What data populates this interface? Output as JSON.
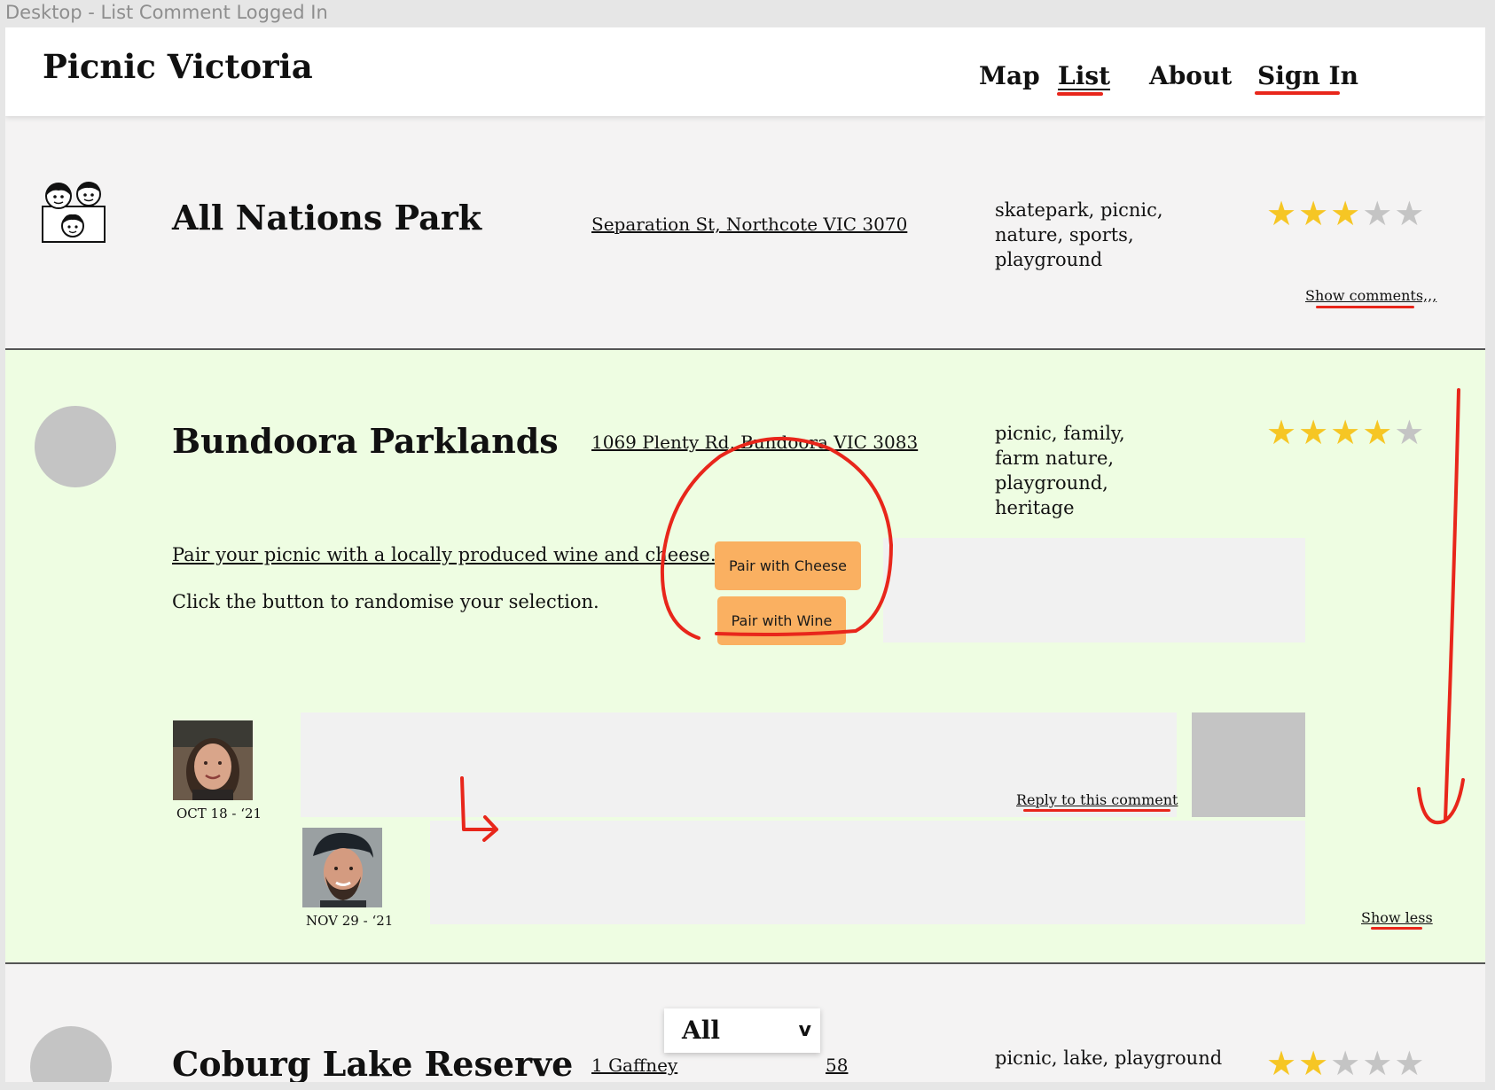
{
  "frame_title": "Desktop - List Comment Logged In",
  "header": {
    "brand": "Picnic Victoria",
    "nav": {
      "map": "Map",
      "list": "List",
      "about": "About",
      "sign_in": "Sign In"
    }
  },
  "parks": [
    {
      "name": "All Nations Park",
      "address": "Separation St, Northcote VIC 3070",
      "tags": "skatepark, picnic, nature, sports, playground",
      "rating": 3,
      "max_rating": 5,
      "icon": "family-icon",
      "toggle_label": "Show comments,,,"
    },
    {
      "name": "Bundoora Parklands",
      "address": "1069 Plenty Rd, Bundoora VIC 3083",
      "tags": "picnic, family, farm nature, playground, heritage",
      "rating": 4,
      "max_rating": 5,
      "pairing": {
        "intro": "Pair your picnic with a locally produced wine and cheese...",
        "instruction": "Click the button to randomise your selection.",
        "cheese_button": "Pair with Cheese",
        "wine_button": "Pair with Wine"
      },
      "comments": [
        {
          "date": "OCT 18 - ‘21",
          "reply_label": "Reply to this comment"
        },
        {
          "date": "NOV 29 - ‘21"
        }
      ],
      "toggle_label": "Show less"
    },
    {
      "name": "Coburg Lake Reserve",
      "address_partial_left": "1 Gaffney",
      "address_partial_right": "58",
      "tags": "picnic, lake, playground",
      "rating": 2,
      "max_rating": 5
    }
  ],
  "filter_dropdown": {
    "selected": "All",
    "chevron": "v"
  },
  "colors": {
    "accent_button": "#fab061",
    "expanded_bg": "#eefde2",
    "star_filled": "#f6c624",
    "star_empty": "#c4c4c4",
    "annotation_red": "#e8261b"
  }
}
